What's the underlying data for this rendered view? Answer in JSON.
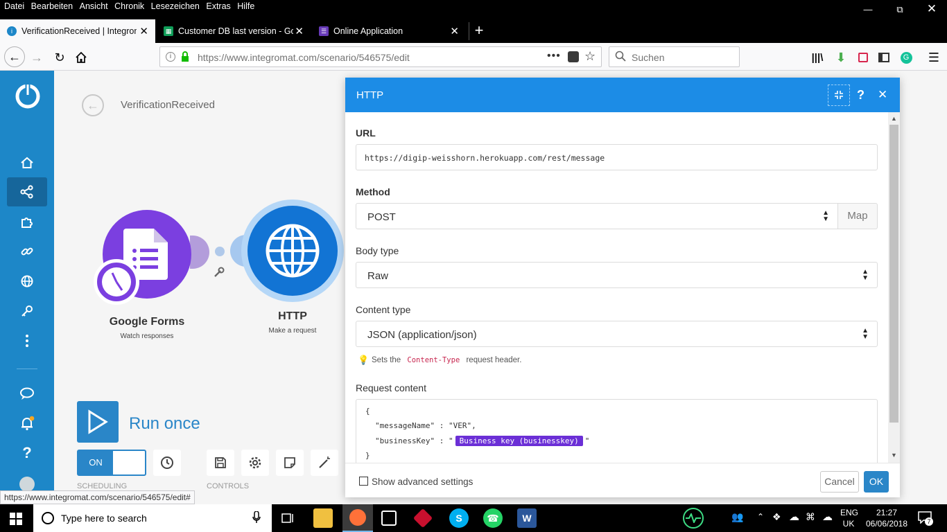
{
  "menubar": {
    "items": [
      "Datei",
      "Bearbeiten",
      "Ansicht",
      "Chronik",
      "Lesezeichen",
      "Extras",
      "Hilfe"
    ]
  },
  "tabs": [
    {
      "label": "VerificationReceived | Integromat",
      "icon": "integromat-icon"
    },
    {
      "label": "Customer DB last version - Google",
      "icon": "sheets-icon"
    },
    {
      "label": "Online Application",
      "icon": "forms-icon"
    }
  ],
  "navbar": {
    "url": "https://www.integromat.com/scenario/546575/edit",
    "search_placeholder": "Suchen"
  },
  "scenario": {
    "title": "VerificationReceived",
    "modules": [
      {
        "name": "Google Forms",
        "subtitle": "Watch responses"
      },
      {
        "name": "HTTP",
        "subtitle": "Make a request"
      }
    ],
    "run_once": "Run once",
    "toggle": "ON",
    "scheduling_label": "SCHEDULING",
    "controls_label": "CONTROLS"
  },
  "modal": {
    "title": "HTTP",
    "url_label": "URL",
    "url_value": "https://digip-weisshorn.herokuapp.com/rest/message",
    "method_label": "Method",
    "method_value": "POST",
    "map_label": "Map",
    "body_type_label": "Body type",
    "body_type_value": "Raw",
    "content_type_label": "Content type",
    "content_type_value": "JSON (application/json)",
    "hint_prefix": "Sets the",
    "hint_code": "Content-Type",
    "hint_suffix": "request header.",
    "request_content_label": "Request content",
    "code_line1": "{",
    "code_line2": "\"messageName\" : \"VER\",",
    "code_line3_prefix": "\"businessKey\" : \"",
    "code_pill": "Business key (businesskey)",
    "code_line3_suffix": "\"",
    "code_line4": "}",
    "advanced_label": "Show advanced settings",
    "cancel_label": "Cancel",
    "ok_label": "OK"
  },
  "status_url": "https://www.integromat.com/scenario/546575/edit#",
  "taskbar": {
    "search_placeholder": "Type here to search",
    "lang_top": "ENG",
    "lang_bottom": "UK",
    "time": "21:27",
    "date": "06/06/2018",
    "notification_count": "7"
  },
  "colors": {
    "integromat_blue": "#1d87c8",
    "modal_header": "#1c8ce6",
    "google_forms_purple": "#7b3fe0",
    "http_blue": "#1274d4",
    "pill_purple": "#6b2fd6"
  }
}
